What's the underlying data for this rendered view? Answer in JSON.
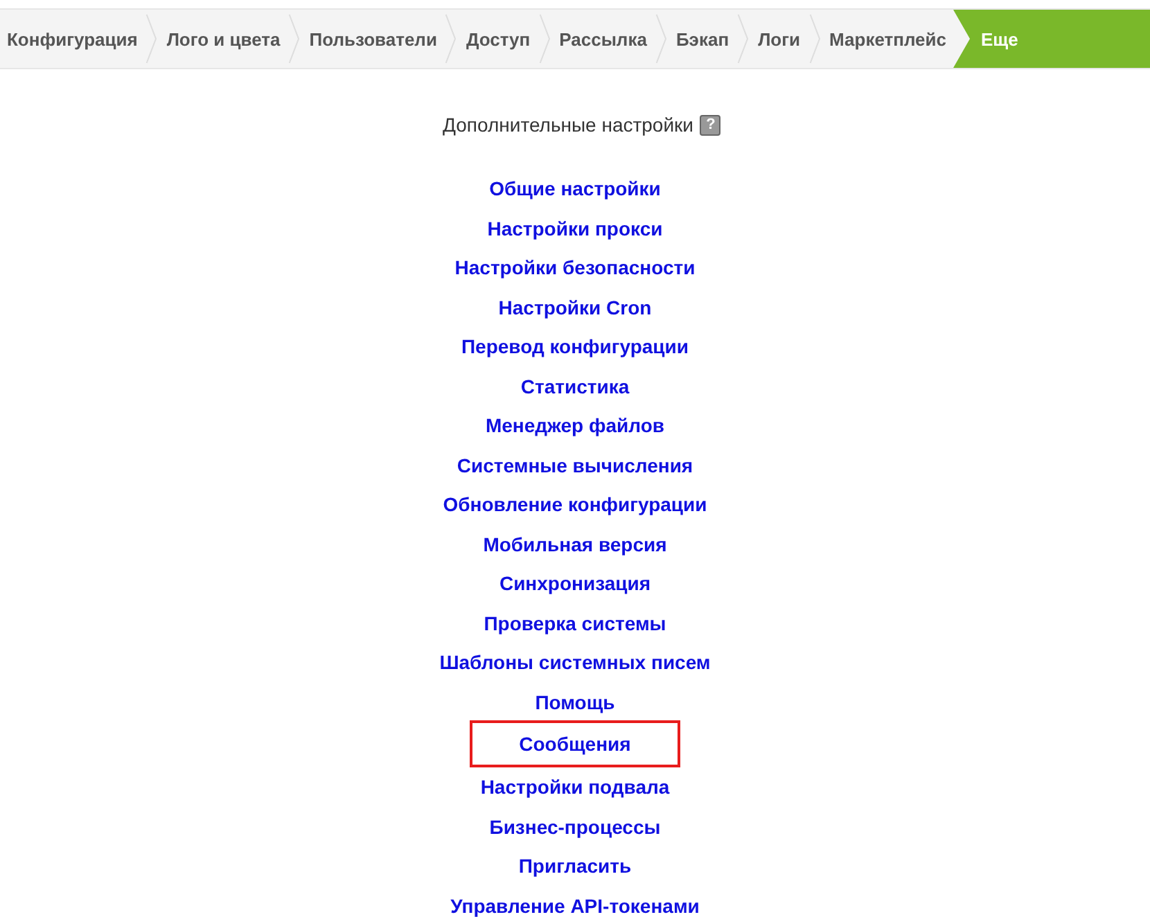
{
  "tabs": [
    {
      "label": "Конфигурация",
      "selected": false
    },
    {
      "label": "Лого и цвета",
      "selected": false
    },
    {
      "label": "Пользователи",
      "selected": false
    },
    {
      "label": "Доступ",
      "selected": false
    },
    {
      "label": "Рассылка",
      "selected": false
    },
    {
      "label": "Бэкап",
      "selected": false
    },
    {
      "label": "Логи",
      "selected": false
    },
    {
      "label": "Маркетплейс",
      "selected": false
    },
    {
      "label": "Еще",
      "selected": true
    }
  ],
  "heading": {
    "text": "Дополнительные настройки",
    "help": "?"
  },
  "links": [
    {
      "label": "Общие настройки",
      "highlighted": false
    },
    {
      "label": "Настройки прокси",
      "highlighted": false
    },
    {
      "label": "Настройки безопасности",
      "highlighted": false
    },
    {
      "label": "Настройки Cron",
      "highlighted": false
    },
    {
      "label": "Перевод конфигурации",
      "highlighted": false
    },
    {
      "label": "Статистика",
      "highlighted": false
    },
    {
      "label": "Менеджер файлов",
      "highlighted": false
    },
    {
      "label": "Системные вычисления",
      "highlighted": false
    },
    {
      "label": "Обновление конфигурации",
      "highlighted": false
    },
    {
      "label": "Мобильная версия",
      "highlighted": false
    },
    {
      "label": "Синхронизация",
      "highlighted": false
    },
    {
      "label": "Проверка системы",
      "highlighted": false
    },
    {
      "label": "Шаблоны системных писем",
      "highlighted": false
    },
    {
      "label": "Помощь",
      "highlighted": false
    },
    {
      "label": "Сообщения",
      "highlighted": true
    },
    {
      "label": "Настройки подвала",
      "highlighted": false
    },
    {
      "label": "Бизнес-процессы",
      "highlighted": false
    },
    {
      "label": "Пригласить",
      "highlighted": false
    },
    {
      "label": "Управление API-токенами",
      "highlighted": false
    }
  ]
}
